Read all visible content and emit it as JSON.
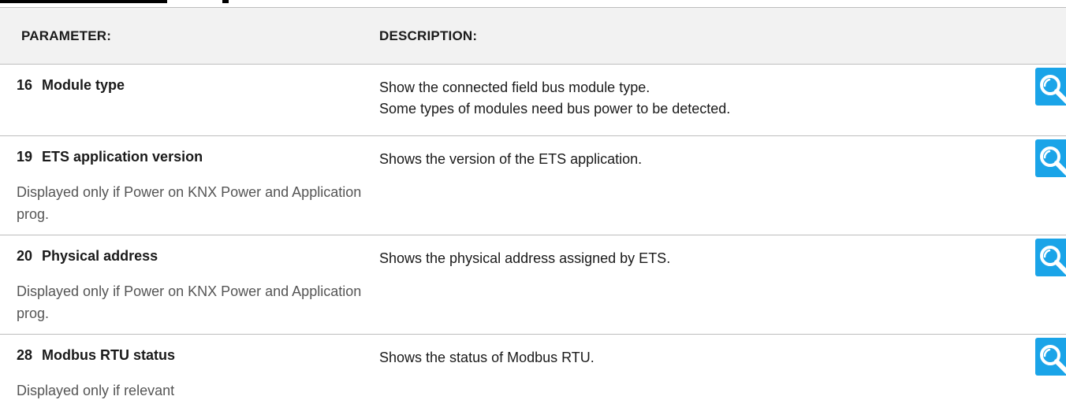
{
  "table": {
    "header": {
      "parameter": "PARAMETER:",
      "description": "DESCRIPTION:"
    },
    "rows": [
      {
        "number": "16",
        "name": "Module type",
        "note": "",
        "description": [
          "Show the connected field bus module type.",
          "Some types of modules need bus power to be detected."
        ],
        "icon": "magnifier-icon"
      },
      {
        "number": "19",
        "name": "ETS application version",
        "note": "Displayed only if Power on KNX Power and Application prog.",
        "description": [
          "Shows the version of the ETS application."
        ],
        "icon": "magnifier-icon"
      },
      {
        "number": "20",
        "name": "Physical address",
        "note": "Displayed only if Power on KNX Power and Application prog.",
        "description": [
          "Shows the physical address assigned by ETS."
        ],
        "icon": "magnifier-icon"
      },
      {
        "number": "28",
        "name": "Modbus RTU status",
        "note": "Displayed only if relevant",
        "description": [
          "Shows the status of Modbus RTU."
        ],
        "icon": "magnifier-icon"
      }
    ]
  },
  "colors": {
    "header_bg": "#f2f2f2",
    "accent": "#1aa4e8",
    "note_text": "#555555",
    "border": "#bdbdbd"
  }
}
